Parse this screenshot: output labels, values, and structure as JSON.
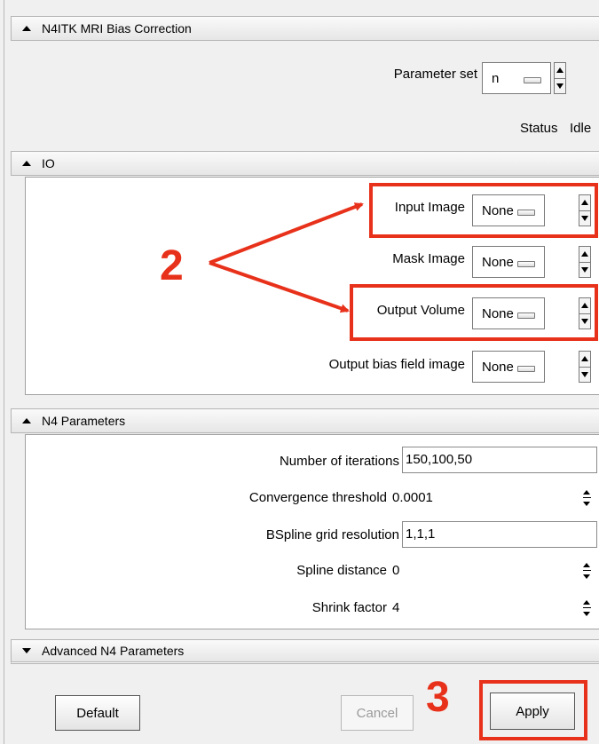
{
  "module": {
    "title": "N4ITK MRI Bias Correction",
    "parameter_set_label": "Parameter set",
    "parameter_set_value": "n",
    "status_label": "Status",
    "status_value": "Idle"
  },
  "io": {
    "title": "IO",
    "rows": [
      {
        "label": "Input Image",
        "value": "None"
      },
      {
        "label": "Mask Image",
        "value": "None"
      },
      {
        "label": "Output Volume",
        "value": "None"
      },
      {
        "label": "Output bias field image",
        "value": "None"
      }
    ]
  },
  "n4": {
    "title": "N4 Parameters",
    "rows": [
      {
        "label": "Number of iterations",
        "value": "150,100,50"
      },
      {
        "label": "Convergence threshold",
        "value": "0.0001"
      },
      {
        "label": "BSpline grid resolution",
        "value": "1,1,1"
      },
      {
        "label": "Spline distance",
        "value": "0"
      },
      {
        "label": "Shrink factor",
        "value": "4"
      }
    ]
  },
  "advanced": {
    "title": "Advanced N4 Parameters"
  },
  "buttons": {
    "default": "Default",
    "cancel": "Cancel",
    "apply": "Apply"
  },
  "annotations": {
    "step2": "2",
    "step3": "3",
    "color": "#e8311a"
  }
}
